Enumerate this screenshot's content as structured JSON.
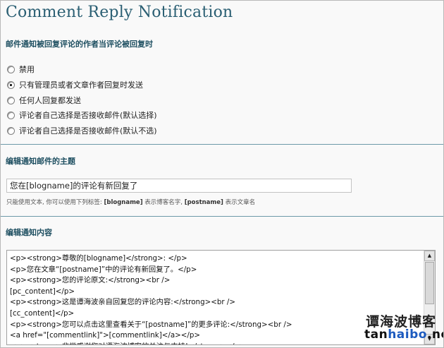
{
  "page": {
    "title": "Comment Reply Notification"
  },
  "mail_notify": {
    "heading": "邮件通知被回复评论的作者当评论被回复时",
    "options": [
      {
        "label": "禁用",
        "checked": false
      },
      {
        "label": "只有管理员或者文章作者回复时发送",
        "checked": true
      },
      {
        "label": "任何人回复都发送",
        "checked": false
      },
      {
        "label": "评论者自己选择是否接收邮件(默认选择)",
        "checked": false
      },
      {
        "label": "评论者自己选择是否接收邮件(默认不选)",
        "checked": false
      }
    ]
  },
  "subject": {
    "heading": "编辑通知邮件的主题",
    "value": "您在[blogname]的评论有新回复了",
    "hint_prefix": "只能使用文本, 你可以使用下列标签:",
    "hint_tag1": "[blogname]",
    "hint_mid": "表示博客名字,",
    "hint_tag2": "[postname]",
    "hint_suffix": "表示文章名"
  },
  "content": {
    "heading": "编辑通知内容",
    "lines": [
      "<p><strong>尊敬的[blogname]</strong>: </p>",
      "<p>您在文章“[postname]”中的评论有新回复了。</p>",
      "<p><strong>您的评论原文:</strong><br />",
      "[pc_content]</p>",
      "<p><strong>这是谭海波亲自回复您的评论内容:</strong><br />",
      "[cc_content]</p>",
      "<p><strong>您可以点击这里查看关于“[postname]”的更多评论:</strong><br />",
      "<a href=\"[commentlink]\">[commentlink]</a></p>",
      "<p><strong>非常感谢您对谭海波博客的关注与支持!</strong></p>"
    ]
  },
  "scrollbar": {
    "up_glyph": "▲",
    "down_glyph": "▼"
  },
  "watermark": {
    "cn": "谭海波博客",
    "en_tan": "tan",
    "en_haibo": "haibo",
    "en_net": ".net"
  }
}
